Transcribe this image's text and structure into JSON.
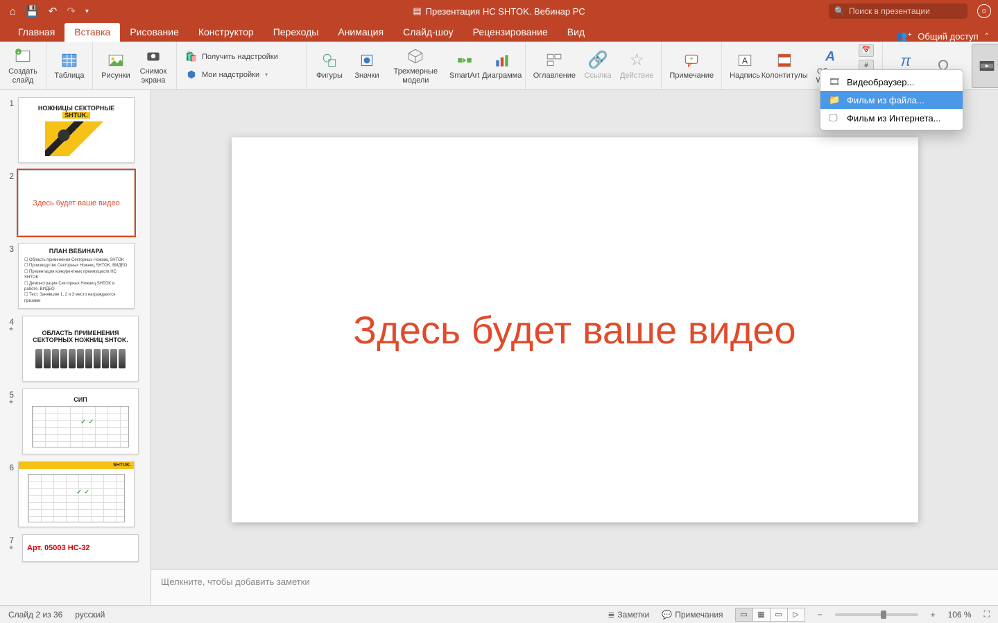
{
  "title_bar": {
    "doc_title": "Презентация НС SHTOK. Вебинар РС",
    "search_placeholder": "Поиск в презентации"
  },
  "tabs": {
    "home": "Главная",
    "insert": "Вставка",
    "draw": "Рисование",
    "design": "Конструктор",
    "transitions": "Переходы",
    "animations": "Анимация",
    "slideshow": "Слайд-шоу",
    "review": "Рецензирование",
    "view": "Вид",
    "share": "Общий доступ"
  },
  "ribbon": {
    "new_slide": "Создать слайд",
    "table": "Таблица",
    "pictures": "Рисунки",
    "screenshot": "Снимок экрана",
    "get_addins": "Получить надстройки",
    "my_addins": "Мои надстройки",
    "shapes": "Фигуры",
    "icons": "Значки",
    "models3d": "Трехмерные модели",
    "smartart": "SmartArt",
    "chart": "Диаграмма",
    "toc": "Оглавление",
    "link": "Ссылка",
    "action": "Действие",
    "comment": "Примечание",
    "textbox": "Надпись",
    "headerfooter": "Колонтитулы",
    "wordart": "Объект WordArt",
    "equation": "Фор"
  },
  "dropdown": {
    "browser": "Видеобраузер...",
    "from_file": "Фильм из файла...",
    "from_web": "Фильм из Интернета..."
  },
  "slides": {
    "s1_title": "НОЖНИЦЫ СЕКТОРНЫЕ",
    "s1_brand": "SHTUK.",
    "s2_text": "Здесь будет ваше видео",
    "s3_title": "ПЛАН ВЕБИНАРА",
    "s3_b1": "Область применения Секторных Ножниц SHTOK",
    "s3_b2": "Производство Секторных Ножниц SHTOK. ВИДЕО",
    "s3_b3": "Презентация конкурентных преимуществ НС SHTOK",
    "s3_b4": "Демонстрация Секторных Ножниц SHTOK в работе. ВИДЕО",
    "s3_b5": "Тест. Занявшие 1, 2 и 3 место награждаются призами",
    "s4_title": "ОБЛАСТЬ ПРИМЕНЕНИЯ СЕКТОРНЫХ НОЖНИЦ SHTOK.",
    "s5_title": "СИП",
    "s6_brand": "SHTUK.",
    "s7_title": "Арт. 05003 НС-32"
  },
  "canvas": {
    "main_text": "Здесь будет ваше видео"
  },
  "notes": {
    "placeholder": "Щелкните, чтобы добавить заметки"
  },
  "status": {
    "slide_counter": "Слайд 2 из 36",
    "language": "русский",
    "notes_btn": "Заметки",
    "comments_btn": "Примечания",
    "zoom": "106 %"
  }
}
